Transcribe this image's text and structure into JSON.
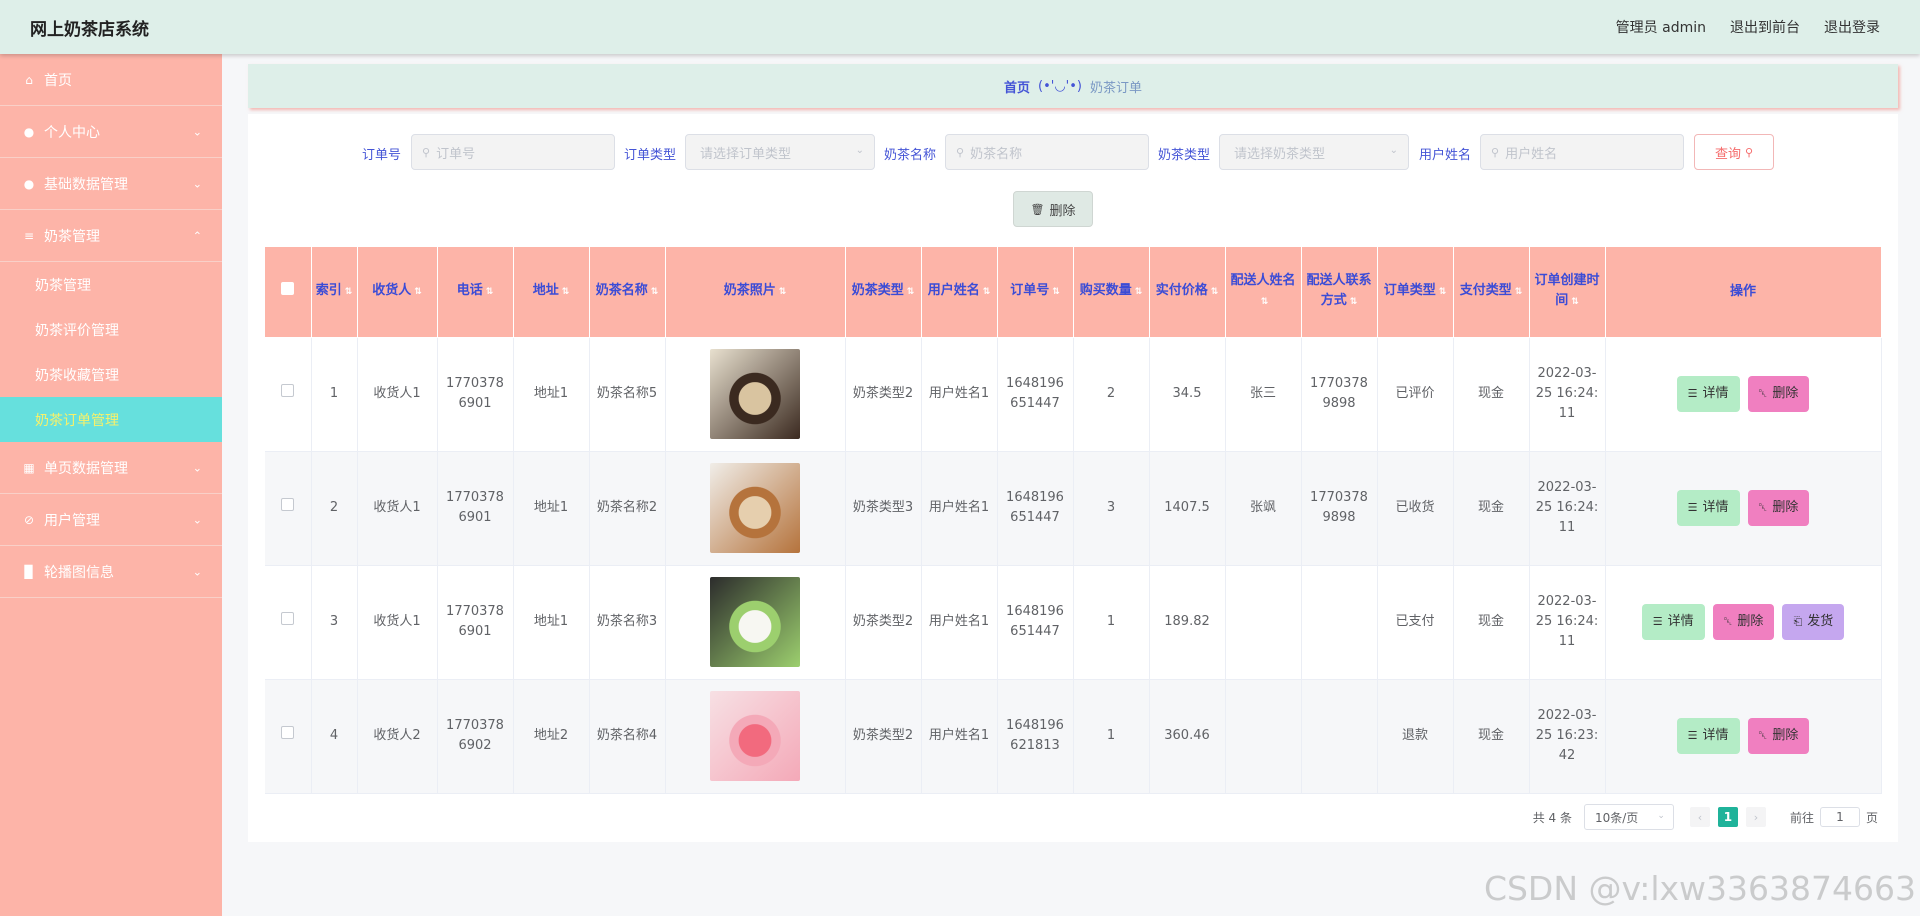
{
  "header": {
    "title": "网上奶茶店系统",
    "admin": "管理员 admin",
    "to_front": "退出到前台",
    "logout": "退出登录"
  },
  "sidebar": {
    "items": [
      {
        "label": "首页",
        "icon": "home-icon",
        "expandable": false
      },
      {
        "label": "个人中心",
        "icon": "user-icon",
        "expandable": true
      },
      {
        "label": "基础数据管理",
        "icon": "user-icon",
        "expandable": true
      },
      {
        "label": "奶茶管理",
        "icon": "sliders-icon",
        "expandable": true,
        "open": true,
        "children": [
          "奶茶管理",
          "奶茶评价管理",
          "奶茶收藏管理",
          "奶茶订单管理"
        ],
        "active_child": 3
      },
      {
        "label": "单页数据管理",
        "icon": "building-icon",
        "expandable": true
      },
      {
        "label": "用户管理",
        "icon": "ban-icon",
        "expandable": true
      },
      {
        "label": "轮播图信息",
        "icon": "bar-chart-icon",
        "expandable": true
      }
    ]
  },
  "breadcrumb": {
    "home": "首页",
    "face": "(•'◡'•)",
    "current": "奶茶订单"
  },
  "filters": {
    "order_no": {
      "label": "订单号",
      "placeholder": "订单号"
    },
    "order_type": {
      "label": "订单类型",
      "placeholder": "请选择订单类型"
    },
    "tea_name": {
      "label": "奶茶名称",
      "placeholder": "奶茶名称"
    },
    "tea_type": {
      "label": "奶茶类型",
      "placeholder": "请选择奶茶类型"
    },
    "user_name": {
      "label": "用户姓名",
      "placeholder": "用户姓名"
    },
    "query": "查询"
  },
  "delete_button": "删除",
  "table": {
    "columns": [
      "索引",
      "收货人",
      "电话",
      "地址",
      "奶茶名称",
      "奶茶照片",
      "奶茶类型",
      "用户姓名",
      "订单号",
      "购买数量",
      "实付价格",
      "配送人姓名",
      "配送人联系方式",
      "订单类型",
      "支付类型",
      "订单创建时间",
      "操作"
    ],
    "rows": [
      {
        "index": "1",
        "receiver": "收货人1",
        "phone": "17703786901",
        "address": "地址1",
        "tea_name": "奶茶名称5",
        "photo": "photo-iced-coffee-cup",
        "photo_colors": [
          "#3b2a20",
          "#d9c4a0",
          "#e8e0cf"
        ],
        "tea_type": "奶茶类型2",
        "user": "用户姓名1",
        "order_no": "1648196651447",
        "qty": "2",
        "price": "34.5",
        "courier": "张三",
        "courier_phone": "17703789898",
        "order_type": "已评价",
        "pay_type": "现金",
        "created": "2022-03-25 16:24:11",
        "actions": [
          "详情",
          "删除"
        ]
      },
      {
        "index": "2",
        "receiver": "收货人1",
        "phone": "17703786901",
        "address": "地址1",
        "tea_name": "奶茶名称2",
        "photo": "photo-milk-tea-glass",
        "photo_colors": [
          "#b5733c",
          "#e6cfae",
          "#f0ede8"
        ],
        "tea_type": "奶茶类型3",
        "user": "用户姓名1",
        "order_no": "1648196651447",
        "qty": "3",
        "price": "1407.5",
        "courier": "张飒",
        "courier_phone": "17703789898",
        "order_type": "已收货",
        "pay_type": "现金",
        "created": "2022-03-25 16:24:11",
        "actions": [
          "详情",
          "删除"
        ]
      },
      {
        "index": "3",
        "receiver": "收货人1",
        "phone": "17703786901",
        "address": "地址1",
        "tea_name": "奶茶名称3",
        "photo": "photo-tall-white-drink",
        "photo_colors": [
          "#9ccf6e",
          "#f7f7f2",
          "#2c2c2c"
        ],
        "tea_type": "奶茶类型2",
        "user": "用户姓名1",
        "order_no": "1648196651447",
        "qty": "1",
        "price": "189.82",
        "courier": "",
        "courier_phone": "",
        "order_type": "已支付",
        "pay_type": "现金",
        "created": "2022-03-25 16:24:11",
        "actions": [
          "详情",
          "删除",
          "发货"
        ]
      },
      {
        "index": "4",
        "receiver": "收货人2",
        "phone": "17703786902",
        "address": "地址2",
        "tea_name": "奶茶名称4",
        "photo": "photo-pink-fruit-drink",
        "photo_colors": [
          "#f4a9b8",
          "#f26a7e",
          "#f7e0e4"
        ],
        "tea_type": "奶茶类型2",
        "user": "用户姓名1",
        "order_no": "1648196621813",
        "qty": "1",
        "price": "360.46",
        "courier": "",
        "courier_phone": "",
        "order_type": "退款",
        "pay_type": "现金",
        "created": "2022-03-25 16:23:42",
        "actions": [
          "详情",
          "删除"
        ]
      }
    ]
  },
  "pagination": {
    "total": "共 4 条",
    "page_size": "10条/页",
    "current_page": "1",
    "goto_label": "前往",
    "goto_value": "1",
    "page_unit": "页"
  },
  "watermark": "CSDN @v:lxw3363874663",
  "colors": {
    "header_bg": "#deefe9",
    "sidebar_bg": "#fdb4a8",
    "sidebar_active": "#66e0dd",
    "th_bg": "#fdb4a8",
    "th_text": "#3b4cd6",
    "pager_active": "#1fb39a"
  }
}
